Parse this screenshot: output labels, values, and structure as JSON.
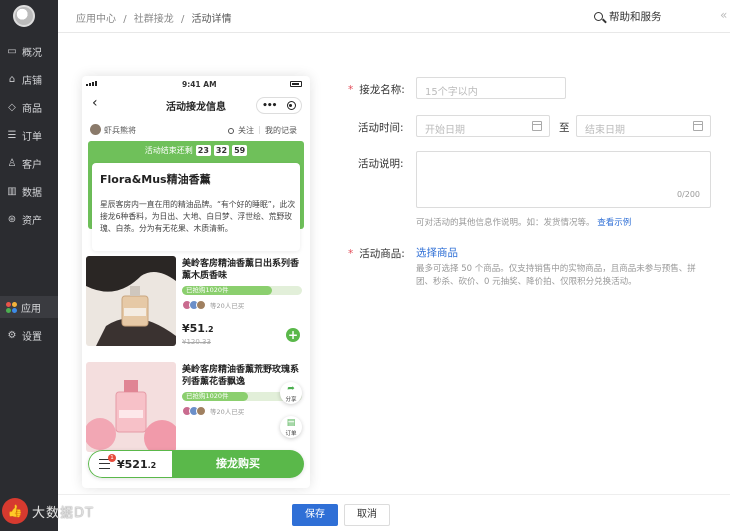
{
  "sidebar": {
    "items": [
      {
        "label": "概况",
        "icon": "monitor-icon"
      },
      {
        "label": "店铺",
        "icon": "store-icon"
      },
      {
        "label": "商品",
        "icon": "tag-icon"
      },
      {
        "label": "订单",
        "icon": "order-icon"
      },
      {
        "label": "客户",
        "icon": "user-icon"
      },
      {
        "label": "数据",
        "icon": "bar-chart-icon"
      },
      {
        "label": "资产",
        "icon": "asset-icon"
      }
    ],
    "apps_label": "应用",
    "settings_label": "设置"
  },
  "header": {
    "breadcrumb": [
      "应用中心",
      "社群接龙",
      "活动详情"
    ],
    "separator": "/",
    "help_label": "帮助和服务",
    "collapse_glyph": "«"
  },
  "phone": {
    "status_time": "9:41 AM",
    "nav_title": "活动接龙信息",
    "back_glyph": "‹",
    "capsule_more": "•••",
    "user_name": "虾兵熊将",
    "follow_label": "关注",
    "record_label": "我的记录",
    "countdown_label": "活动结束还剩",
    "countdown": [
      "23",
      "32",
      "59"
    ],
    "activity_title": "Flora&Mus精油香薰",
    "activity_desc": "星辰客房内一直在用的精油品牌。“有个好的睡眠”，此次接龙6种香料，为日出、大地、白日梦、浮世绘、荒野玫瑰、白茶。分为有无花果、木质清新。",
    "products": [
      {
        "title": "美岭客房精油香薰日出系列香薰木质香味",
        "sold": "已抢购1020件",
        "progress": 0.75,
        "buyers": "等20人已买",
        "price_int": "¥51",
        "price_dec": ".2",
        "orig": "¥120.33"
      },
      {
        "title": "美岭客房精油香薰荒野玫瑰系列香薰花香飘逸",
        "sold": "已抢购1020件",
        "progress": 0.55,
        "buyers": "等20人已买"
      }
    ],
    "share_label": "分享",
    "order_label": "订单",
    "cart_badge": "1",
    "cart_total_int": "¥521",
    "cart_total_dec": ".2",
    "buy_label": "接龙购买"
  },
  "form": {
    "name_label": "接龙名称:",
    "name_placeholder": "15个字以内",
    "time_label": "活动时间:",
    "start_placeholder": "开始日期",
    "to_label": "至",
    "end_placeholder": "结束日期",
    "desc_label": "活动说明:",
    "desc_counter": "0/200",
    "desc_help": "可对活动的其他信息作说明。如：发货情况等。",
    "desc_help_link": "查看示例",
    "goods_label": "活动商品:",
    "goods_link": "选择商品",
    "goods_help_1": "最多可选择 50 个商品。仅支持销售中的实物商品，且商品未参与预售、拼",
    "goods_help_2": "团、秒杀、砍价、0 元抽奖、降价拍、仅限积分兑换活动。"
  },
  "footer": {
    "save_label": "保存",
    "cancel_label": "取消"
  },
  "watermark": {
    "text": "大数据DT"
  },
  "colors": {
    "sidebar_bg": "#2b2c30",
    "accent_blue": "#2f6fd6",
    "accent_green": "#5ab84a",
    "required_red": "#e34d59"
  }
}
